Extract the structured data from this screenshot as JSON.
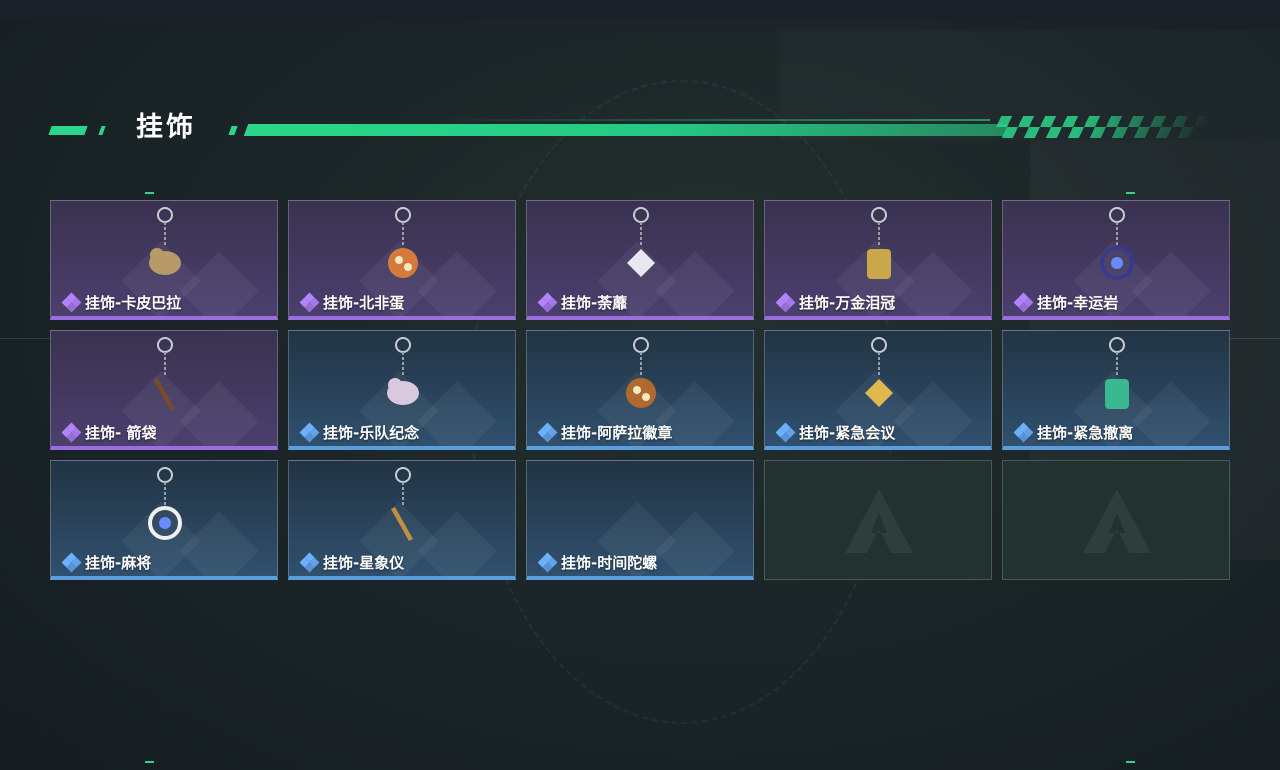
{
  "section": {
    "title": "挂饰"
  },
  "charms": [
    {
      "name": "挂饰-卡皮巴拉",
      "rarity": "purple",
      "icon": "capybara-charm-icon",
      "color": "#b89a68"
    },
    {
      "name": "挂饰-北非蛋",
      "rarity": "purple",
      "icon": "shakshuka-charm-icon",
      "color": "#d47a3a"
    },
    {
      "name": "挂饰-荼蘼",
      "rarity": "purple",
      "icon": "flower-charm-icon",
      "color": "#e8e8f0"
    },
    {
      "name": "挂饰-万金泪冠",
      "rarity": "purple",
      "icon": "crown-charm-icon",
      "color": "#c8a84a"
    },
    {
      "name": "挂饰-幸运岩",
      "rarity": "purple",
      "icon": "lucky-rock-charm-icon",
      "color": "#3a3a8a"
    },
    {
      "name": "挂饰- 箭袋",
      "rarity": "purple",
      "icon": "quiver-charm-icon",
      "color": "#7a4a2a"
    },
    {
      "name": "挂饰-乐队纪念",
      "rarity": "blue",
      "icon": "band-badge-charm-icon",
      "color": "#d8c8e0"
    },
    {
      "name": "挂饰-阿萨拉徽章",
      "rarity": "blue",
      "icon": "asala-badge-charm-icon",
      "color": "#b06a30"
    },
    {
      "name": "挂饰-紧急会议",
      "rarity": "blue",
      "icon": "emergency-meeting-charm-icon",
      "color": "#e0b850"
    },
    {
      "name": "挂饰-紧急撤离",
      "rarity": "blue",
      "icon": "emergency-evac-charm-icon",
      "color": "#3ab890"
    },
    {
      "name": "挂饰-麻将",
      "rarity": "blue",
      "icon": "mahjong-charm-icon",
      "color": "#f0f0f0"
    },
    {
      "name": "挂饰-星象仪",
      "rarity": "blue",
      "icon": "astrolabe-charm-icon",
      "color": "#c09040"
    },
    {
      "name": "挂饰-时间陀螺",
      "rarity": "blue",
      "icon": "time-top-charm-icon",
      "color": ""
    },
    {
      "name": "",
      "rarity": "empty",
      "icon": "delta-logo-icon",
      "color": ""
    },
    {
      "name": "",
      "rarity": "empty",
      "icon": "delta-logo-icon",
      "color": ""
    }
  ]
}
